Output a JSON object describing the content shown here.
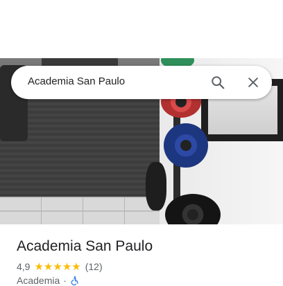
{
  "search": {
    "query": "Academia San Paulo"
  },
  "place": {
    "name": "Academia San Paulo",
    "rating": "4,9",
    "stars": 5,
    "review_count": "(12)",
    "category": "Academia",
    "separator": "·"
  },
  "icons": {
    "search": "search-icon",
    "close": "close-icon",
    "star": "star-icon",
    "accessibility": "wheelchair-accessible-icon"
  },
  "colors": {
    "star": "#fbbc04",
    "accessibility": "#1a73e8",
    "text_primary": "#202124",
    "text_secondary": "#5f6368"
  }
}
